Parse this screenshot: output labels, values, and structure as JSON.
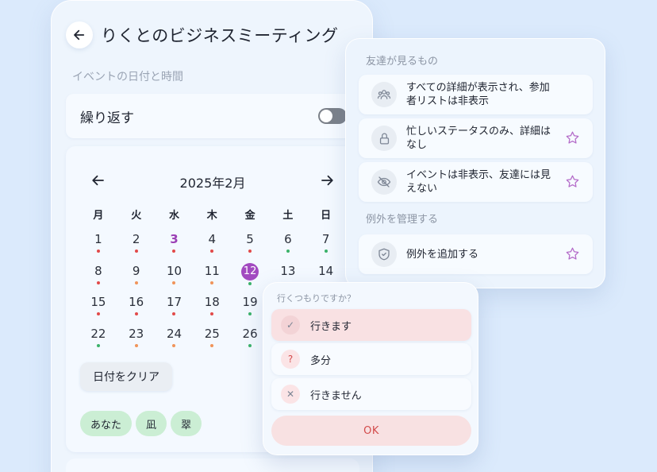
{
  "header": {
    "title": "りくとのビジネスミーティング"
  },
  "event": {
    "section_label": "イベントの日付と時間",
    "repeat_label": "繰り返す",
    "repeat_enabled": false
  },
  "calendar": {
    "month": "2025年2月",
    "weekdays": [
      "月",
      "火",
      "水",
      "木",
      "金",
      "土",
      "日"
    ],
    "days": [
      {
        "n": "1",
        "dot": "#e24a4a"
      },
      {
        "n": "2",
        "dot": "#e24a4a"
      },
      {
        "n": "3",
        "dot": "#e24a4a",
        "today": true
      },
      {
        "n": "4",
        "dot": "#e24a4a"
      },
      {
        "n": "5",
        "dot": "#e24a4a"
      },
      {
        "n": "6",
        "dot": "#3bb26a"
      },
      {
        "n": "7",
        "dot": "#3bb26a"
      },
      {
        "n": "8",
        "dot": "#e24a4a"
      },
      {
        "n": "9",
        "dot": "#f0945a"
      },
      {
        "n": "10",
        "dot": "#f0945a"
      },
      {
        "n": "11",
        "dot": "#f0945a"
      },
      {
        "n": "12",
        "dot": "#3bb26a",
        "selected": true
      },
      {
        "n": "13",
        "dot": ""
      },
      {
        "n": "14",
        "dot": ""
      },
      {
        "n": "15",
        "dot": "#e24a4a"
      },
      {
        "n": "16",
        "dot": "#e24a4a"
      },
      {
        "n": "17",
        "dot": "#e24a4a"
      },
      {
        "n": "18",
        "dot": "#e24a4a"
      },
      {
        "n": "19",
        "dot": "#3bb26a"
      },
      {
        "n": "",
        "dot": ""
      },
      {
        "n": "",
        "dot": ""
      },
      {
        "n": "22",
        "dot": "#3bb26a"
      },
      {
        "n": "23",
        "dot": "#f0945a"
      },
      {
        "n": "24",
        "dot": "#f0945a"
      },
      {
        "n": "25",
        "dot": "#f0945a"
      },
      {
        "n": "26",
        "dot": "#3bb26a"
      },
      {
        "n": "",
        "dot": ""
      },
      {
        "n": "",
        "dot": ""
      }
    ],
    "clear_label": "日付をクリア",
    "chips": [
      "あなた",
      "凪",
      "翠"
    ]
  },
  "friends_panel": {
    "heading": "友達が見るもの",
    "options": [
      {
        "icon": "people-icon",
        "text": "すべての詳細が表示され、参加者リストは非表示",
        "star": false
      },
      {
        "icon": "lock-icon",
        "text": "忙しいステータスのみ、詳細はなし",
        "star": true
      },
      {
        "icon": "eye-off-icon",
        "text": "イベントは非表示、友達には見えない",
        "star": true
      }
    ],
    "exceptions_heading": "例外を管理する",
    "exception_option": {
      "icon": "shield-icon",
      "text": "例外を追加する",
      "star": true
    }
  },
  "rsvp": {
    "title": "行くつもりですか？",
    "options": [
      {
        "icon": "check-icon",
        "glyph": "✓",
        "label": "行きます",
        "active": true
      },
      {
        "icon": "question-icon",
        "glyph": "?",
        "label": "多分",
        "active": false
      },
      {
        "icon": "x-icon",
        "glyph": "✕",
        "label": "行きません",
        "active": false
      }
    ],
    "ok_label": "OK"
  },
  "colors": {
    "accent": "#a24ac0",
    "dot_red": "#e24a4a",
    "dot_orange": "#f0945a",
    "dot_green": "#3bb26a",
    "chip_green": "#cbeed4",
    "ok_text": "#d34b4b"
  }
}
